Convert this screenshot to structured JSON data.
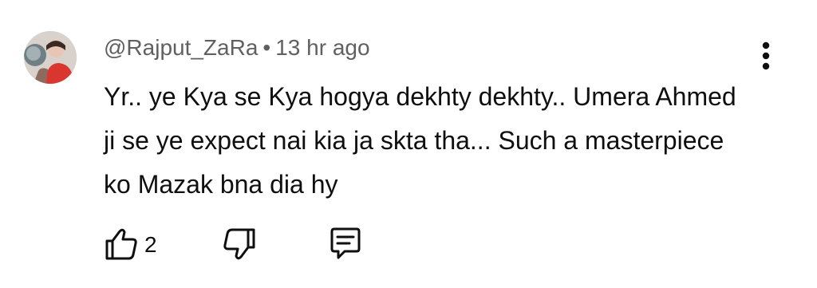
{
  "comment": {
    "author": "@Rajput_ZaRa",
    "separator": "•",
    "time": "13 hr ago",
    "text": "Yr.. ye Kya se Kya hogya dekhty dekhty.. Umera Ahmed ji se ye expect nai kia ja skta tha... Such a masterpiece ko Mazak bna dia hy",
    "like_count": "2"
  },
  "icons": {
    "avatar": "avatar-image",
    "more": "more-vert-icon",
    "like": "thumbs-up-icon",
    "dislike": "thumbs-down-icon",
    "reply": "reply-comment-icon"
  },
  "colors": {
    "meta_text": "#606060",
    "body_text": "#0f0f0f",
    "background": "#ffffff"
  }
}
